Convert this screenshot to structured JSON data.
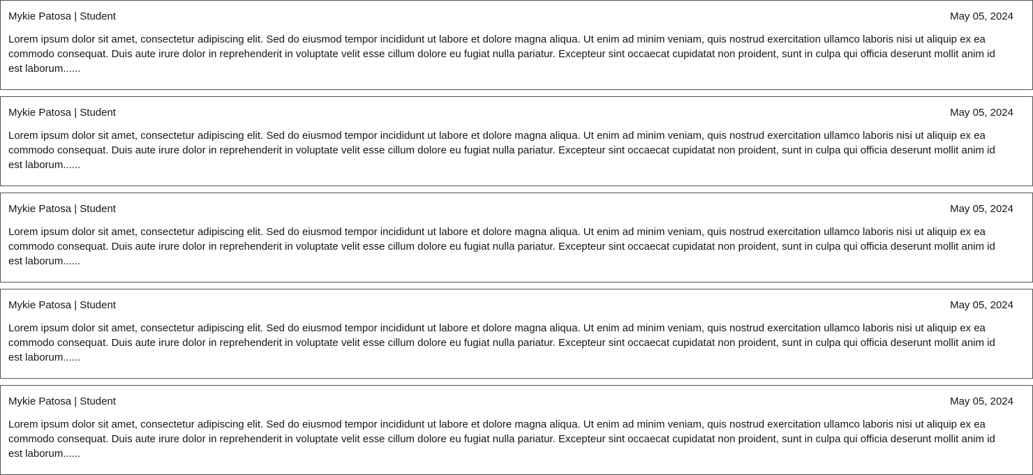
{
  "comments": [
    {
      "author": "Mykie Patosa | Student",
      "date": "May 05, 2024",
      "text": "Lorem ipsum dolor sit amet, consectetur adipiscing elit. Sed do eiusmod tempor incididunt ut labore et dolore magna aliqua. Ut enim ad minim veniam, quis nostrud exercitation ullamco laboris nisi ut aliquip ex ea commodo consequat. Duis aute irure dolor in reprehenderit in voluptate velit esse cillum dolore eu fugiat nulla pariatur. Excepteur sint occaecat cupidatat non proident, sunt in culpa qui officia deserunt mollit anim id est laborum......"
    },
    {
      "author": "Mykie Patosa | Student",
      "date": "May 05, 2024",
      "text": "Lorem ipsum dolor sit amet, consectetur adipiscing elit. Sed do eiusmod tempor incididunt ut labore et dolore magna aliqua. Ut enim ad minim veniam, quis nostrud exercitation ullamco laboris nisi ut aliquip ex ea commodo consequat. Duis aute irure dolor in reprehenderit in voluptate velit esse cillum dolore eu fugiat nulla pariatur. Excepteur sint occaecat cupidatat non proident, sunt in culpa qui officia deserunt mollit anim id est laborum......"
    },
    {
      "author": "Mykie Patosa | Student",
      "date": "May 05, 2024",
      "text": "Lorem ipsum dolor sit amet, consectetur adipiscing elit. Sed do eiusmod tempor incididunt ut labore et dolore magna aliqua. Ut enim ad minim veniam, quis nostrud exercitation ullamco laboris nisi ut aliquip ex ea commodo consequat. Duis aute irure dolor in reprehenderit in voluptate velit esse cillum dolore eu fugiat nulla pariatur. Excepteur sint occaecat cupidatat non proident, sunt in culpa qui officia deserunt mollit anim id est laborum......"
    },
    {
      "author": "Mykie Patosa | Student",
      "date": "May 05, 2024",
      "text": "Lorem ipsum dolor sit amet, consectetur adipiscing elit. Sed do eiusmod tempor incididunt ut labore et dolore magna aliqua. Ut enim ad minim veniam, quis nostrud exercitation ullamco laboris nisi ut aliquip ex ea commodo consequat. Duis aute irure dolor in reprehenderit in voluptate velit esse cillum dolore eu fugiat nulla pariatur. Excepteur sint occaecat cupidatat non proident, sunt in culpa qui officia deserunt mollit anim id est laborum......"
    },
    {
      "author": "Mykie Patosa | Student",
      "date": "May 05, 2024",
      "text": "Lorem ipsum dolor sit amet, consectetur adipiscing elit. Sed do eiusmod tempor incididunt ut labore et dolore magna aliqua. Ut enim ad minim veniam, quis nostrud exercitation ullamco laboris nisi ut aliquip ex ea commodo consequat. Duis aute irure dolor in reprehenderit in voluptate velit esse cillum dolore eu fugiat nulla pariatur. Excepteur sint occaecat cupidatat non proident, sunt in culpa qui officia deserunt mollit anim id est laborum......"
    }
  ]
}
